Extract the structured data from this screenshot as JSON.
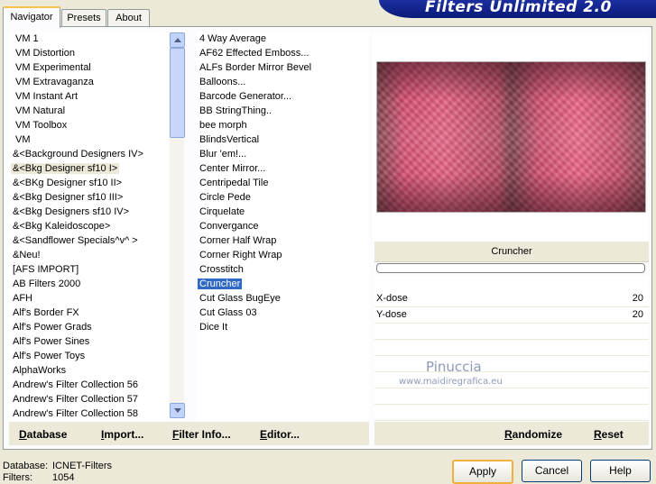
{
  "window": {
    "title": "Filters Unlimited 2.0"
  },
  "tabs": [
    {
      "label": "Navigator",
      "active": true
    },
    {
      "label": "Presets",
      "active": false
    },
    {
      "label": "About",
      "active": false
    }
  ],
  "categories": [
    "VM 1",
    "VM Distortion",
    "VM Experimental",
    "VM Extravaganza",
    "VM Instant Art",
    "VM Natural",
    "VM Toolbox",
    "VM",
    "&<Background Designers IV>",
    "&<Bkg Designer sf10 I>",
    "&<BKg Designer sf10 II>",
    "&<Bkg Designer sf10 III>",
    "&<Bkg Designers sf10 IV>",
    "&<Bkg Kaleidoscope>",
    "&<Sandflower Specials^v^ >",
    "&Neu!",
    "[AFS IMPORT]",
    "AB Filters 2000",
    "AFH",
    "Alf's Border FX",
    "Alf's Power Grads",
    "Alf's Power Sines",
    "Alf's Power Toys",
    "AlphaWorks",
    "Andrew's Filter Collection 56",
    "Andrew's Filter Collection 57",
    "Andrew's Filter Collection 58"
  ],
  "selected_category": "&<Bkg Designer sf10 I>",
  "filters": [
    "4 Way Average",
    "AF62 Effected Emboss...",
    "ALFs Border Mirror Bevel",
    "Balloons...",
    "Barcode Generator...",
    "BB StringThing..",
    "bee morph",
    "BlindsVertical",
    "Blur 'em!...",
    "Center Mirror...",
    "Centripedal Tile",
    "Circle Pede",
    "Cirquelate",
    "Convergance",
    "Corner Half Wrap",
    "Corner Right Wrap",
    "Crosstitch",
    "Cruncher",
    "Cut Glass  BugEye",
    "Cut Glass 03",
    "Dice It"
  ],
  "selected_filter": "Cruncher",
  "preview": {
    "filter_name": "Cruncher"
  },
  "params": [
    {
      "label": "X-dose",
      "value": "20"
    },
    {
      "label": "Y-dose",
      "value": "20"
    }
  ],
  "watermark": {
    "line1": "Pinuccia",
    "line2": "www.maidiregrafica.eu"
  },
  "toolbar_left": {
    "database": "Database",
    "import": "Import...",
    "filter_info": "Filter Info...",
    "editor": "Editor..."
  },
  "toolbar_right": {
    "randomize": "Randomize",
    "reset": "Reset"
  },
  "status": {
    "database_label": "Database:",
    "database_value": "ICNET-Filters",
    "filters_label": "Filters:",
    "filters_value": "1054"
  },
  "buttons": {
    "apply": "Apply",
    "cancel": "Cancel",
    "help": "Help"
  },
  "colors": {
    "selection": "#316ac5",
    "banner": "#1b2f9e",
    "window_bg": "#ece9d8"
  }
}
